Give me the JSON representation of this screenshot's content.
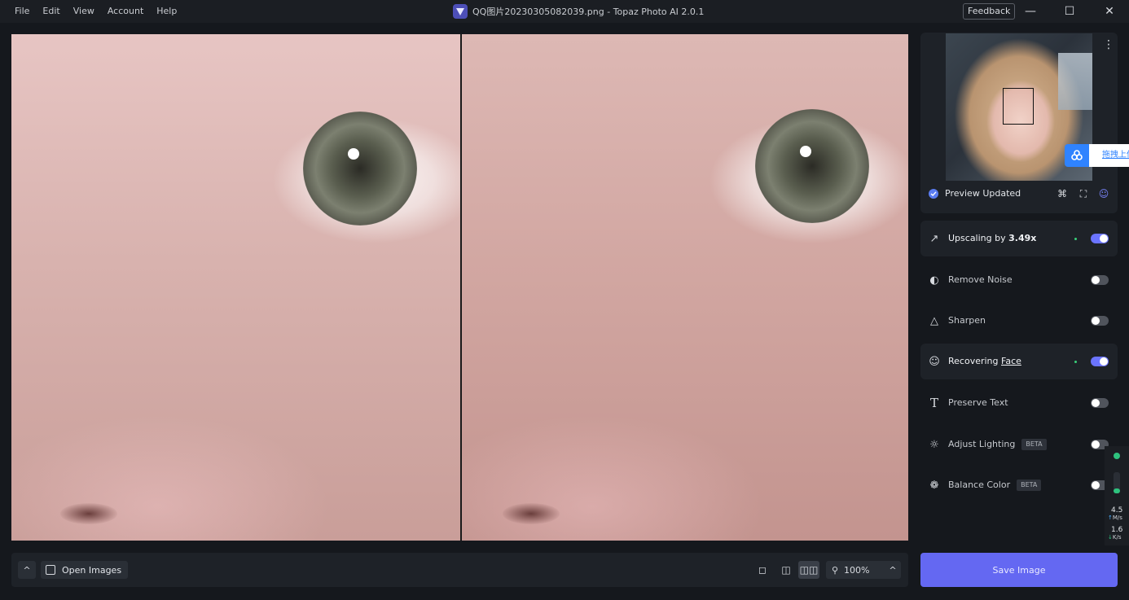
{
  "menu": {
    "file": "File",
    "edit": "Edit",
    "view": "View",
    "account": "Account",
    "help": "Help"
  },
  "window": {
    "title": "QQ图片20230305082039.png - Topaz Photo AI 2.0.1",
    "feedback": "Feedback"
  },
  "bottombar": {
    "open_images": "Open Images",
    "zoom": "100%"
  },
  "preview": {
    "status": "Preview Updated"
  },
  "baidu": {
    "label": "拖拽上传"
  },
  "tools": {
    "upscaling_prefix": "Upscaling by ",
    "upscaling_value": "3.49x",
    "remove_noise": "Remove Noise",
    "sharpen": "Sharpen",
    "recovering_prefix": "Recovering ",
    "recovering_face": "Face",
    "preserve_text": "Preserve Text",
    "adjust_lighting": "Adjust Lighting",
    "balance_color": "Balance Color",
    "beta": "BETA"
  },
  "toggles": {
    "upscaling": true,
    "remove_noise": false,
    "sharpen": false,
    "recovering_face": true,
    "preserve_text": false,
    "adjust_lighting": false,
    "balance_color": false
  },
  "save": {
    "label": "Save Image"
  },
  "network": {
    "upload_value": "4.5",
    "upload_unit": "M/s",
    "download_value": "1.6",
    "download_unit": "K/s",
    "up_arrow": "↑",
    "down_arrow": "↓"
  },
  "colors": {
    "accent": "#6468f2",
    "toggle_on": "#6b74ff",
    "status_dot": "#39d07a",
    "background": "#15181d"
  }
}
